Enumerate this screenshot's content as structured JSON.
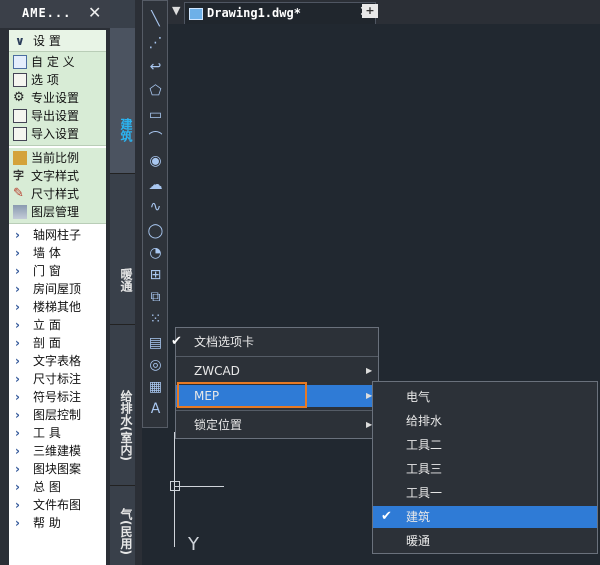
{
  "palette": {
    "title": "AME...",
    "settings_header": "设 置",
    "settings_items": [
      "自 定 义",
      "选 项",
      "专业设置",
      "导出设置",
      "导入设置"
    ],
    "style_items": [
      "当前比例",
      "文字样式",
      "尺寸样式",
      "图层管理"
    ],
    "menu_items": [
      "轴网柱子",
      "墙 体",
      "门 窗",
      "房间屋顶",
      "楼梯其他",
      "立 面",
      "剖 面",
      "文字表格",
      "尺寸标注",
      "符号标注",
      "图层控制",
      "工 具",
      "三维建模",
      "图块图案",
      "总 图",
      "文件布图",
      "帮 助"
    ],
    "close_glyph": "✕"
  },
  "side_tabs": [
    "建筑",
    "暖通",
    "给排水(室内)",
    "气(民用)"
  ],
  "document_tabs": {
    "active": "Drawing1.dwg*",
    "close_glyph": "✕",
    "new_tab_glyph": "+"
  },
  "canvas": {
    "ucs_label": "Y"
  },
  "context_menu": {
    "items": [
      {
        "label": "文档选项卡",
        "checked": true,
        "has_submenu": false
      },
      {
        "label": "ZWCAD",
        "checked": false,
        "has_submenu": true
      },
      {
        "label": "MEP",
        "checked": false,
        "has_submenu": true,
        "highlighted": true
      },
      {
        "label": "锁定位置",
        "checked": false,
        "has_submenu": true
      }
    ]
  },
  "submenu": {
    "items": [
      {
        "label": "电气",
        "checked": false
      },
      {
        "label": "给排水",
        "checked": false
      },
      {
        "label": "工具二",
        "checked": false
      },
      {
        "label": "工具三",
        "checked": false
      },
      {
        "label": "工具一",
        "checked": false
      },
      {
        "label": "建筑",
        "checked": true,
        "highlighted": true
      },
      {
        "label": "暖通",
        "checked": false
      }
    ]
  },
  "colors": {
    "highlight": "#2f7bd6",
    "outline": "#e87a24",
    "active_tab_text": "#2bb3f0"
  }
}
